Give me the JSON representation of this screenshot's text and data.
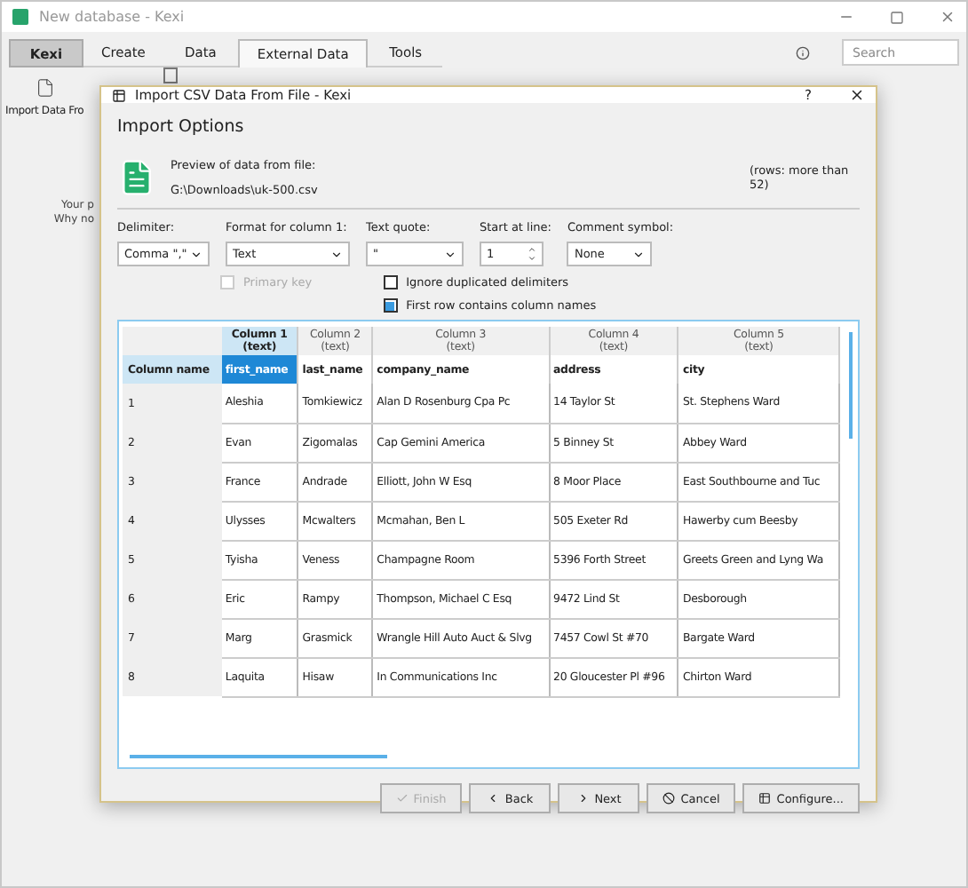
{
  "window": {
    "title": "New database - Kexi"
  },
  "tabs": [
    {
      "label": "Kexi",
      "kind": "app",
      "selected": false
    },
    {
      "label": "Create",
      "kind": "tab",
      "selected": false
    },
    {
      "label": "Data",
      "kind": "tab",
      "selected": false
    },
    {
      "label": "External Data",
      "kind": "tab",
      "selected": true
    },
    {
      "label": "Tools",
      "kind": "tab",
      "selected": false
    }
  ],
  "search": {
    "placeholder": "Search"
  },
  "ribbon": {
    "button_label": "Import Data Fro"
  },
  "background_text": [
    "Your p",
    "Why no"
  ],
  "dialog": {
    "title": "Import CSV Data From File - Kexi",
    "help": "?",
    "heading": "Import Options",
    "preview_label": "Preview of data from file:",
    "file_path": "G:\\Downloads\\uk-500.csv",
    "rows_info": "(rows: more than 52)",
    "options": [
      {
        "label": "Delimiter:",
        "kind": "select",
        "value": "Comma \",\""
      },
      {
        "label": "Format for column 1:",
        "kind": "select",
        "value": "Text"
      },
      {
        "label": "Text quote:",
        "kind": "select",
        "value": "\""
      },
      {
        "label": "Start at line:",
        "kind": "spin",
        "value": "1"
      },
      {
        "label": "Comment symbol:",
        "kind": "select",
        "value": "None"
      }
    ],
    "checkboxes": [
      {
        "label": "Primary key",
        "checked": false,
        "disabled": true
      },
      {
        "label": "Ignore duplicated delimiters",
        "checked": false,
        "disabled": false
      },
      {
        "label": "First row contains column names",
        "checked": true,
        "disabled": false
      }
    ],
    "table": {
      "row_header_label": "Column name",
      "columns": [
        {
          "title": "Column 1",
          "type": "(text)",
          "name": "first_name",
          "selected": true
        },
        {
          "title": "Column 2",
          "type": "(text)",
          "name": "last_name",
          "selected": false
        },
        {
          "title": "Column 3",
          "type": "(text)",
          "name": "company_name",
          "selected": false
        },
        {
          "title": "Column 4",
          "type": "(text)",
          "name": "address",
          "selected": false
        },
        {
          "title": "Column 5",
          "type": "(text)",
          "name": "city",
          "selected": false
        }
      ],
      "rows": [
        {
          "number": "1",
          "cells": [
            "Aleshia",
            "Tomkiewicz",
            "Alan D Rosenburg Cpa Pc",
            "14 Taylor St",
            "St. Stephens Ward"
          ]
        },
        {
          "number": "2",
          "cells": [
            "Evan",
            "Zigomalas",
            "Cap Gemini America",
            "5 Binney St",
            "Abbey Ward"
          ]
        },
        {
          "number": "3",
          "cells": [
            "France",
            "Andrade",
            "Elliott, John W Esq",
            "8 Moor Place",
            "East Southbourne and Tuc"
          ]
        },
        {
          "number": "4",
          "cells": [
            "Ulysses",
            "Mcwalters",
            "Mcmahan, Ben L",
            "505 Exeter Rd",
            "Hawerby cum Beesby"
          ]
        },
        {
          "number": "5",
          "cells": [
            "Tyisha",
            "Veness",
            "Champagne Room",
            "5396 Forth Street",
            "Greets Green and Lyng Wa"
          ]
        },
        {
          "number": "6",
          "cells": [
            "Eric",
            "Rampy",
            "Thompson, Michael C Esq",
            "9472 Lind St",
            "Desborough"
          ]
        },
        {
          "number": "7",
          "cells": [
            "Marg",
            "Grasmick",
            "Wrangle Hill Auto Auct & Slvg",
            "7457 Cowl St #70",
            "Bargate Ward"
          ]
        },
        {
          "number": "8",
          "cells": [
            "Laquita",
            "Hisaw",
            "In Communications Inc",
            "20 Gloucester Pl #96",
            "Chirton Ward"
          ]
        }
      ]
    },
    "buttons": [
      {
        "label": "Finish",
        "kind": "finish",
        "disabled": true
      },
      {
        "label": "Back",
        "kind": "back",
        "disabled": false
      },
      {
        "label": "Next",
        "kind": "next",
        "disabled": false
      },
      {
        "label": "Cancel",
        "kind": "cancel",
        "disabled": false
      },
      {
        "label": "Configure...",
        "kind": "configure",
        "disabled": false
      }
    ]
  }
}
